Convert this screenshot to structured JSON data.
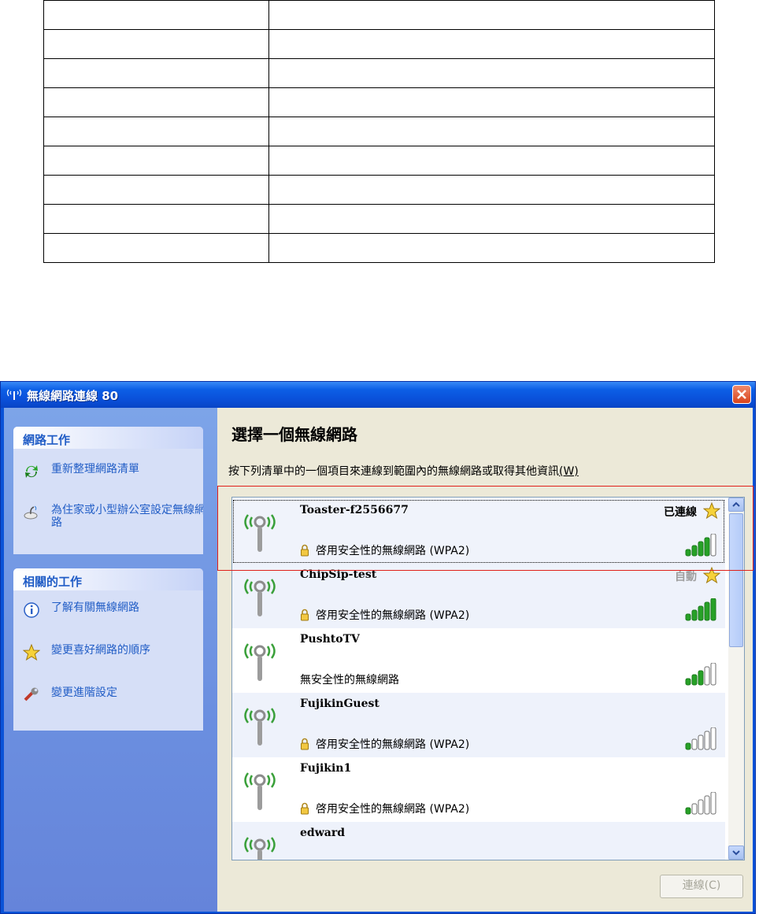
{
  "window": {
    "title": "無線網路連線 80",
    "close_label": "✕"
  },
  "left": {
    "network_tasks": {
      "header": "網路工作",
      "items": [
        {
          "label": "重新整理網路清單",
          "icon": "refresh-icon"
        },
        {
          "label": "為住家或小型辦公室設定無線網路",
          "icon": "home-network-setup-icon"
        }
      ]
    },
    "related_tasks": {
      "header": "相關的工作",
      "items": [
        {
          "label": "了解有關無線網路",
          "icon": "info-icon"
        },
        {
          "label": "變更喜好網路的順序",
          "icon": "star-icon"
        },
        {
          "label": "變更進階設定",
          "icon": "wrench-icon"
        }
      ]
    }
  },
  "main": {
    "heading": "選擇一個無線網路",
    "instruction": "按下列清單中的一個項目來連線到範圍內的無線網路或取得其他資訊",
    "instruction_key": "(W)",
    "networks": [
      {
        "ssid": "Toaster-f2556677",
        "security": "啓用安全性的無線網路 (WPA2)",
        "secured": true,
        "status": "已連線",
        "preferred": true,
        "signal_bars": 4,
        "selected": true
      },
      {
        "ssid": "ChipSip-test",
        "security": "啓用安全性的無線網路 (WPA2)",
        "secured": true,
        "status": "自動",
        "preferred": true,
        "signal_bars": 5,
        "selected": false
      },
      {
        "ssid": "PushtoTV",
        "security": "無安全性的無線網路",
        "secured": false,
        "status": "",
        "preferred": false,
        "signal_bars": 3,
        "selected": false
      },
      {
        "ssid": "FujikinGuest",
        "security": "啓用安全性的無線網路 (WPA2)",
        "secured": true,
        "status": "",
        "preferred": false,
        "signal_bars": 1,
        "selected": false
      },
      {
        "ssid": "Fujikin1",
        "security": "啓用安全性的無線網路 (WPA2)",
        "secured": true,
        "status": "",
        "preferred": false,
        "signal_bars": 1,
        "selected": false
      },
      {
        "ssid": "edward",
        "security": "",
        "secured": false,
        "status": "",
        "preferred": false,
        "signal_bars": 0,
        "selected": false
      }
    ],
    "connect_button": "連線(C)"
  },
  "colors": {
    "link": "#215dc6",
    "highlight": "#e0201a",
    "signal_on": "#27a127",
    "signal_off": "#ffffff"
  }
}
